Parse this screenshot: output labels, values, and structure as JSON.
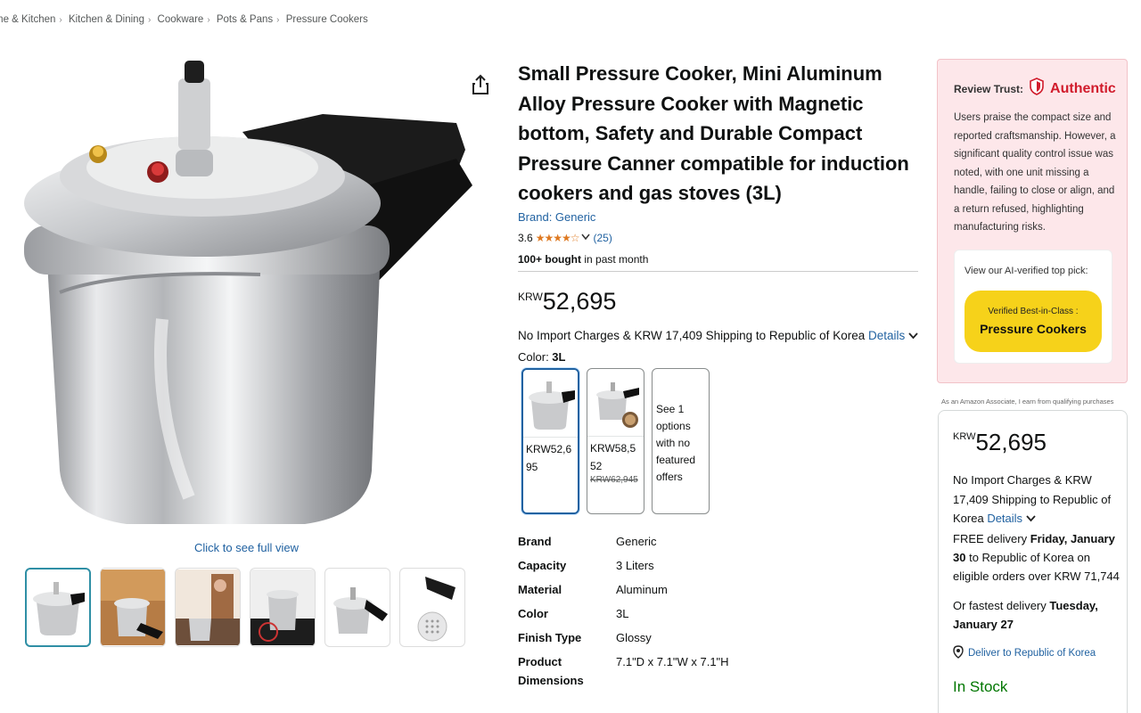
{
  "breadcrumb": {
    "items": [
      "me & Kitchen",
      "Kitchen & Dining",
      "Cookware",
      "Pots & Pans",
      "Pressure Cookers"
    ],
    "separator": "›"
  },
  "gallery": {
    "full_view_label": "Click to see full view",
    "thumbnail_count": 6
  },
  "product": {
    "title": "Small Pressure Cooker, Mini Aluminum Alloy Pressure Cooker with Magnetic bottom, Safety and Durable Compact Pressure Canner compatible for induction cookers and gas stoves (3L)",
    "brand": "Brand: Generic",
    "rating": "3.6",
    "stars": "★★★★☆",
    "rating_count": "(25)",
    "bought_bold": "100+ bought",
    "bought_rest": " in past month",
    "price_currency": "KRW",
    "price_amount": "52,695",
    "shipping_text": "No Import Charges & KRW 17,409 Shipping to Republic of Korea ",
    "details_label": "Details",
    "color_label": "Color: ",
    "color_value": "3L"
  },
  "swatches": [
    {
      "price": "KRW52,695",
      "strike": ""
    },
    {
      "price": "KRW58,552",
      "strike": "KRW62,945"
    },
    {
      "see_text": "See 1 options with no featured offers"
    }
  ],
  "specs": [
    {
      "key": "Brand",
      "value": "Generic"
    },
    {
      "key": "Capacity",
      "value": "3 Liters"
    },
    {
      "key": "Material",
      "value": "Aluminum"
    },
    {
      "key": "Color",
      "value": "3L"
    },
    {
      "key": "Finish Type",
      "value": "Glossy"
    },
    {
      "key": "Product Dimensions",
      "value": "7.1\"D x 7.1\"W x 7.1\"H"
    }
  ],
  "trust": {
    "label": "Review Trust:",
    "verdict": "Authentic",
    "summary": "Users praise the compact size and reported craftsmanship. However, a significant quality control issue was noted, with one unit missing a handle, failing to close or align, and a return refused, highlighting manufacturing risks.",
    "pick_label": "View our AI-verified top pick:",
    "pick_small": "Verified Best-in-Class :",
    "pick_big": "Pressure Cookers"
  },
  "associate_note": "As an Amazon Associate, I earn from qualifying purchases",
  "buybox": {
    "price_currency": "KRW",
    "price_amount": "52,695",
    "ship_text": "No Import Charges & KRW 17,409 Shipping to Republic of Korea ",
    "details_label": "Details",
    "free_delivery_pre": "FREE delivery ",
    "free_delivery_date": "Friday, January 30",
    "free_delivery_post": " to Republic of Korea on eligible orders over KRW 71,744",
    "fast_pre": "Or fastest delivery ",
    "fast_date": "Tuesday, January 27",
    "deliver_to": "Deliver to Republic of Korea",
    "stock": "In Stock"
  },
  "colors": {
    "link": "#2162a1",
    "star": "#de7921",
    "authentic": "#d11c2c",
    "stock": "#007600",
    "pick_button": "#f6d21a",
    "trust_bg": "#fde7ea"
  }
}
